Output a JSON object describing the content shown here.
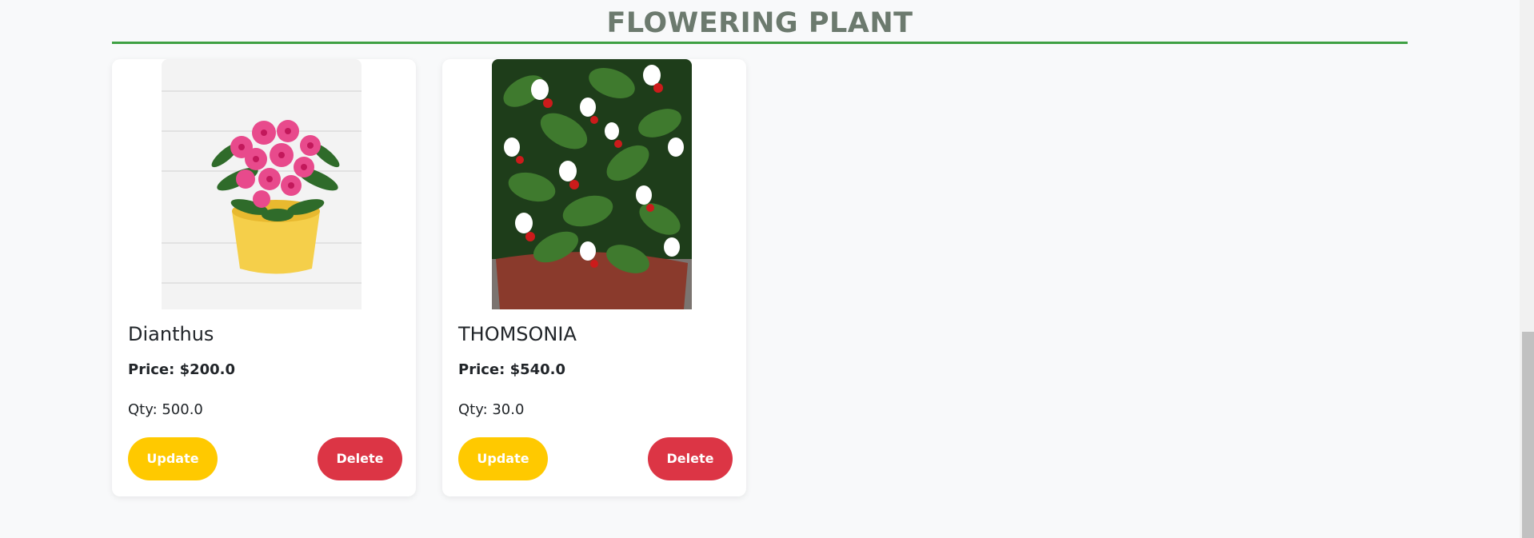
{
  "section": {
    "title": "FLOWERING PLANT",
    "accent_color": "#3ea043"
  },
  "products": [
    {
      "name": "Dianthus",
      "price": "Price: $200.0",
      "qty": "Qty: 500.0",
      "image": "potted-pink-dianthus-image",
      "update_label": "Update",
      "delete_label": "Delete"
    },
    {
      "name": "THOMSONIA",
      "price": "Price: $540.0",
      "qty": "Qty: 30.0",
      "image": "bleeding-heart-vine-image",
      "update_label": "Update",
      "delete_label": "Delete"
    }
  ],
  "colors": {
    "update_button": "#ffc900",
    "delete_button": "#dc3545",
    "title_text": "#6c7a6e"
  }
}
